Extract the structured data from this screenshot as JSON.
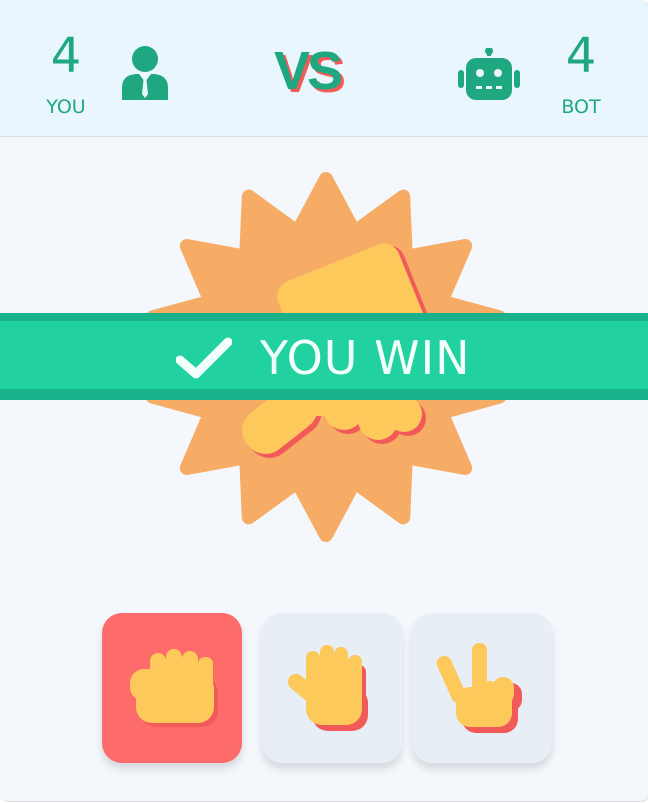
{
  "scoreboard": {
    "player": {
      "score": "4",
      "label": "YOU",
      "icon": "businessman-icon"
    },
    "vs_label": "VS",
    "bot": {
      "score": "4",
      "label": "BOT",
      "icon": "robot-icon"
    }
  },
  "result": {
    "text": "YOU WIN",
    "icon": "checkmark-icon",
    "shown_hands": [
      "paper-hand-icon",
      "rock-fist-icon"
    ]
  },
  "choices": [
    {
      "name": "rock",
      "icon": "rock-fist-icon",
      "selected": true
    },
    {
      "name": "paper",
      "icon": "paper-hand-icon",
      "selected": false
    },
    {
      "name": "scissors",
      "icon": "scissors-hand-icon",
      "selected": false
    }
  ],
  "colors": {
    "accent": "#1fa87f",
    "banner": "#21d19f",
    "starburst": "#f6ac65",
    "hand": "#fdc95b",
    "hand_shadow": "#f25a5a",
    "selected_choice": "#fe6b6b",
    "choice_bg": "#e8eef6"
  }
}
